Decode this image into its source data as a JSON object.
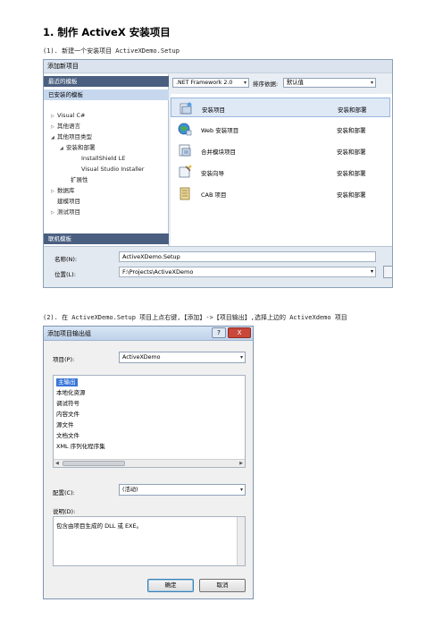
{
  "document": {
    "title": "1. 制作 ActiveX 安装项目",
    "step1": "(1). 新建一个安装项目 ActiveXDemo.Setup",
    "step2": "(2). 在 ActiveXDemo.Setup 项目上点右键,【添加】->【项目输出】,选择上边的 ActiveXdemo 项目"
  },
  "add_project_dialog": {
    "title": "添加新项目",
    "recent_templates": "最近的模板",
    "installed_templates": "已安装的模板",
    "tree": [
      {
        "label": "Visual C#",
        "expander": "▷"
      },
      {
        "label": "其他语言",
        "expander": "▷"
      },
      {
        "label": "其他项目类型",
        "expander": "◢"
      },
      {
        "label": "安装和部署",
        "expander": "◢"
      },
      {
        "label": "InstallShield LE",
        "expander": ""
      },
      {
        "label": "Visual Studio Installer",
        "expander": ""
      },
      {
        "label": "扩展性",
        "expander": ""
      },
      {
        "label": "数据库",
        "expander": "▷"
      },
      {
        "label": "建模项目",
        "expander": ""
      },
      {
        "label": "测试项目",
        "expander": "▷"
      }
    ],
    "online_templates": "联机模板",
    "framework": ".NET Framework 2.0",
    "sort_label": "排序依据:",
    "sort_value": "默认值",
    "templates": [
      {
        "name": "安装项目",
        "category": "安装和部署",
        "icon": "setup-project-icon",
        "selected": true
      },
      {
        "name": "Web 安装项目",
        "category": "安装和部署",
        "icon": "web-setup-icon",
        "selected": false
      },
      {
        "name": "合并模块项目",
        "category": "安装和部署",
        "icon": "merge-module-icon",
        "selected": false
      },
      {
        "name": "安装向导",
        "category": "安装和部署",
        "icon": "setup-wizard-icon",
        "selected": false
      },
      {
        "name": "CAB 项目",
        "category": "安装和部署",
        "icon": "cab-project-icon",
        "selected": false
      }
    ],
    "name_label": "名称(N):",
    "name_value": "ActiveXDemo.Setup",
    "location_label": "位置(L):",
    "location_value": "F:\\Projects\\ActiveXDemo"
  },
  "output_group_dialog": {
    "title": "添加项目输出组",
    "help_button": "?",
    "close_button": "X",
    "project_label": "项目(P):",
    "project_value": "ActiveXDemo",
    "outputs": [
      "主输出",
      "本地化资源",
      "调试符号",
      "内容文件",
      "源文件",
      "文档文件",
      "XML 序列化程序集"
    ],
    "config_label": "配置(C):",
    "config_value": "(活动)",
    "description_label": "说明(D):",
    "description_text": "包含由项目生成的 DLL 或 EXE。",
    "ok_button": "确定",
    "cancel_button": "取消"
  }
}
